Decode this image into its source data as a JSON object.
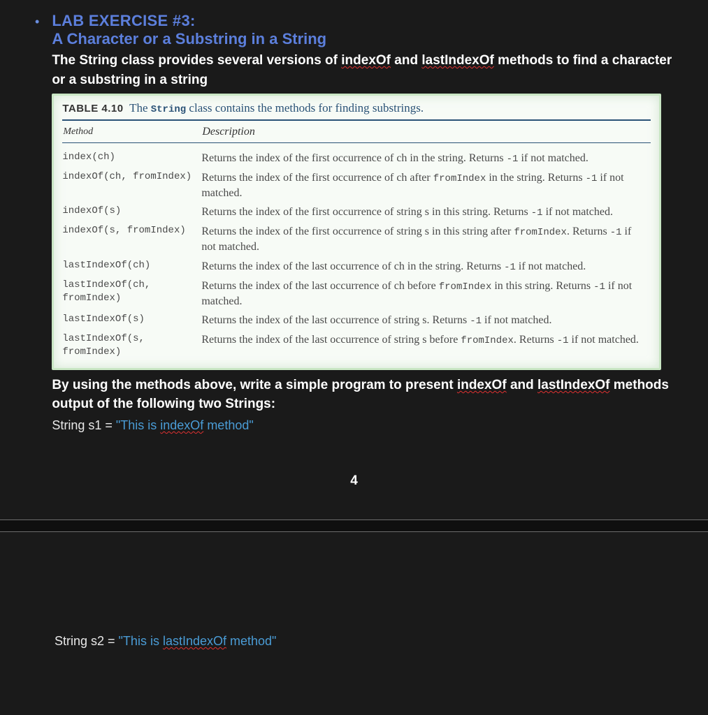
{
  "header": {
    "title1": "LAB EXERCISE #3:",
    "title2": "A Character or a Substring in a String"
  },
  "intro": {
    "pre": "The String class provides several versions of ",
    "w1": "indexOf",
    "mid": " and ",
    "w2": "lastIndexOf",
    "post": " methods to find a character or a substring in a string"
  },
  "table": {
    "label": "TABLE 4.10",
    "caption_pre": "The ",
    "caption_string": "String",
    "caption_post": " class contains the methods for finding substrings.",
    "head_method": "Method",
    "head_desc": "Description",
    "rows": [
      {
        "m": "index(ch)",
        "d_pre": "Returns the index of the first occurrence of ch in the string. Returns ",
        "d_m1": "-1",
        "d_post": " if not matched."
      },
      {
        "m": "indexOf(ch, fromIndex)",
        "d_pre": "Returns the index of the first occurrence of ch after ",
        "d_m1": "fromIndex",
        "d_mid": " in the string. Returns ",
        "d_m2": "-1",
        "d_post": " if not matched."
      },
      {
        "m": "indexOf(s)",
        "d_pre": "Returns the index of the first occurrence of string s in this string. Returns ",
        "d_m1": "-1",
        "d_post": " if not matched."
      },
      {
        "m": "indexOf(s, fromIndex)",
        "d_pre": "Returns the index of the first occurrence of string s in this string after ",
        "d_m1": "fromIndex",
        "d_mid": ". Returns ",
        "d_m2": "-1",
        "d_post": " if not matched."
      },
      {
        "m": "lastIndexOf(ch)",
        "d_pre": "Returns the index of the last occurrence of ch in the string. Returns ",
        "d_m1": "-1",
        "d_post": " if not matched."
      },
      {
        "m": "lastIndexOf(ch, fromIndex)",
        "d_pre": "Returns the index of the last occurrence of ch before ",
        "d_m1": "fromIndex",
        "d_mid": " in this string. Returns ",
        "d_m2": "-1",
        "d_post": " if not matched."
      },
      {
        "m": "lastIndexOf(s)",
        "d_pre": "Returns the index of the last occurrence of string s. Returns ",
        "d_m1": "-1",
        "d_post": " if not matched."
      },
      {
        "m": "lastIndexOf(s, fromIndex)",
        "d_pre": "Returns the index of the last occurrence of string s before ",
        "d_m1": "fromIndex",
        "d_mid": ". Returns ",
        "d_m2": "-1",
        "d_post": " if not matched."
      }
    ]
  },
  "instr": {
    "pre": "By using the methods above, write a simple program to present ",
    "w1": "indexOf",
    "mid": " and ",
    "w2": "lastIndexOf",
    "post": " methods output of the following two Strings:"
  },
  "code1": {
    "prefix": "String s1 = ",
    "q1": "\"This is ",
    "kw": "indexOf",
    "q2": " method\""
  },
  "page_number": "4",
  "code2": {
    "prefix": "String s2 = ",
    "q1": "\"This is ",
    "kw": "lastIndexOf",
    "q2": " method\""
  }
}
